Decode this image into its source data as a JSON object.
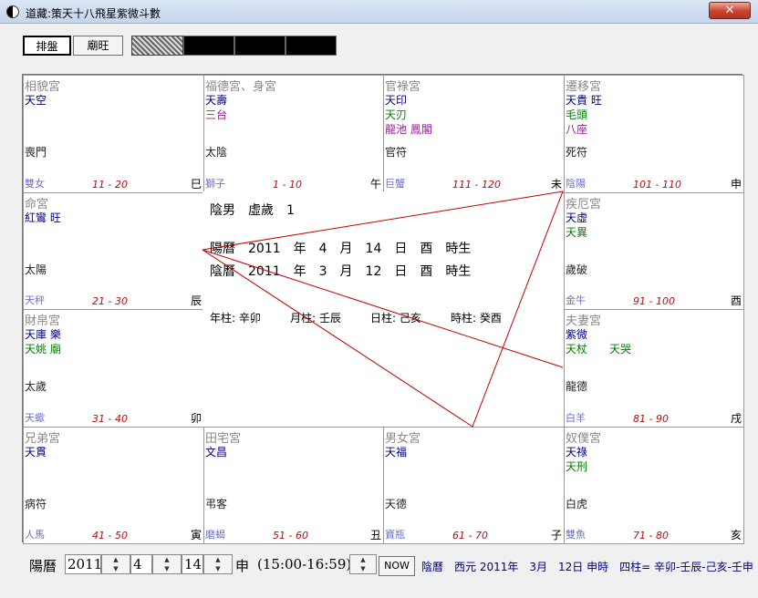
{
  "window": {
    "title": "道藏:策天十八飛星紫微斗數",
    "close_label": "✕"
  },
  "toolbar": {
    "arrange_label": "排盤",
    "temple_label": "廟旺"
  },
  "palaces": [
    {
      "key": "xiangmao",
      "name": "相貌宮",
      "stars": [
        {
          "text": "天空",
          "color": "blue"
        }
      ],
      "spirit": "喪門",
      "constellation": "雙女",
      "age": "11 - 20",
      "branch": "巳"
    },
    {
      "key": "fude",
      "name": "福德宮、身宮",
      "stars": [
        {
          "text": "天壽",
          "color": "blue"
        },
        {
          "text": "三台",
          "color": "purple"
        }
      ],
      "spirit": "太陰",
      "constellation": "獅子",
      "age": "1 - 10",
      "branch": "午"
    },
    {
      "key": "guanlu",
      "name": "官祿宮",
      "stars": [
        {
          "text": "天印",
          "color": "blue"
        },
        {
          "text": "天刃",
          "color": "green"
        },
        {
          "text": "龍池 鳳閣",
          "color": "purple"
        }
      ],
      "spirit": "官符",
      "constellation": "巨蟹",
      "age": "111 - 120",
      "branch": "未"
    },
    {
      "key": "qianyi",
      "name": "遷移宮",
      "stars": [
        {
          "text": "天貴 旺",
          "color": "blue"
        },
        {
          "text": "毛頭",
          "color": "green"
        },
        {
          "text": "八座",
          "color": "purple"
        }
      ],
      "spirit": "死符",
      "constellation": "陰陽",
      "age": "101 - 110",
      "branch": "申"
    },
    {
      "key": "ming",
      "name": "命宮",
      "stars": [
        {
          "text": "紅鸞 旺",
          "color": "blue"
        }
      ],
      "spirit": "太陽",
      "constellation": "天秤",
      "age": "21 - 30",
      "branch": "辰"
    },
    {
      "key": "jie",
      "name": "疾厄宮",
      "stars": [
        {
          "text": "天虛",
          "color": "blue"
        },
        {
          "text": "天異",
          "color": "green"
        }
      ],
      "spirit": "歲破",
      "constellation": "金牛",
      "age": "91 - 100",
      "branch": "酉"
    },
    {
      "key": "caibo",
      "name": "財帛宮",
      "stars": [
        {
          "text": "天庫 樂",
          "color": "blue"
        },
        {
          "text": "天姚 廟",
          "color": "green"
        }
      ],
      "spirit": "太歲",
      "constellation": "天蠍",
      "age": "31 - 40",
      "branch": "卯"
    },
    {
      "key": "fuqi",
      "name": "夫妻宮",
      "stars": [
        {
          "text": "紫微",
          "color": "blue"
        },
        {
          "text": "天杖　　天哭",
          "color": "green"
        }
      ],
      "spirit": "龍德",
      "constellation": "白羊",
      "age": "81 - 90",
      "branch": "戌"
    },
    {
      "key": "xiongdi",
      "name": "兄弟宮",
      "stars": [
        {
          "text": "天貫",
          "color": "blue"
        }
      ],
      "spirit": "病符",
      "constellation": "人馬",
      "age": "41 - 50",
      "branch": "寅"
    },
    {
      "key": "tianzhai",
      "name": "田宅宮",
      "stars": [
        {
          "text": "文昌",
          "color": "blue"
        }
      ],
      "spirit": "弔客",
      "constellation": "磨蝎",
      "age": "51 - 60",
      "branch": "丑"
    },
    {
      "key": "nannv",
      "name": "男女宮",
      "stars": [
        {
          "text": "天福",
          "color": "blue"
        }
      ],
      "spirit": "天德",
      "constellation": "寶瓶",
      "age": "61 - 70",
      "branch": "子"
    },
    {
      "key": "nupu",
      "name": "奴僕宮",
      "stars": [
        {
          "text": "天祿",
          "color": "blue"
        },
        {
          "text": "天刑",
          "color": "green"
        }
      ],
      "spirit": "白虎",
      "constellation": "雙魚",
      "age": "71 - 80",
      "branch": "亥"
    }
  ],
  "center": {
    "gender_age": "陰男　虛歲　1",
    "solar": "陽曆　2011　年　4　月　14　日　酉　時生",
    "lunar": "陰曆　2011　年　3　月　12　日　酉　時生",
    "pillars": [
      "年柱:  辛卯",
      "月柱:  壬辰",
      "日柱:  己亥",
      "時柱:  癸酉"
    ]
  },
  "controls": {
    "calendar_label": "陽曆",
    "year": "2011",
    "month": "4",
    "day": "14",
    "hour_branch": "申",
    "hour_range": "(15:00-16:59)",
    "now_label": "NOW",
    "status": "陰曆　西元 2011年　3月　12日 申時　四柱= 辛卯-壬辰-己亥-壬申"
  },
  "colors": {
    "star_blue": "#000080",
    "star_green": "#008000",
    "star_purple": "#9a189a",
    "age_red": "#b01010",
    "constellation": "#7070c8",
    "chart_line": "#c00000"
  }
}
